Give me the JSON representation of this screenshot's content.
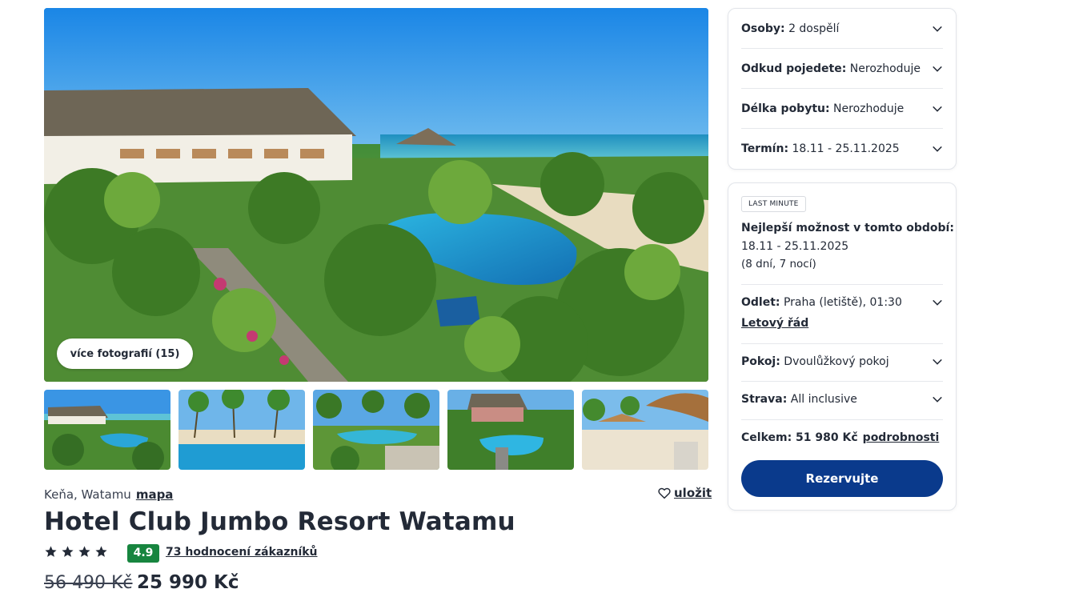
{
  "gallery": {
    "more_photos_label": "více fotografií (15)"
  },
  "hotel": {
    "location": "Keňa, Watamu",
    "map_link": "mapa",
    "save_label": "uložit",
    "name": "Hotel Club Jumbo Resort Watamu",
    "stars": 4,
    "rating": "4.9",
    "reviews_label": "73 hodnocení zákazníků",
    "old_price": "56 490 Kč",
    "price": "25 990 Kč",
    "rating_color": "#17853f"
  },
  "filters": [
    {
      "label": "Osoby:",
      "value": "2 dospělí"
    },
    {
      "label": "Odkud pojedete:",
      "value": "Nerozhoduje"
    },
    {
      "label": "Délka pobytu:",
      "value": "Nerozhoduje"
    },
    {
      "label": "Termín:",
      "value": "18.11 - 25.11.2025"
    }
  ],
  "offer": {
    "badge": "LAST MINUTE",
    "best_title": "Nejlepší možnost v tomto období:",
    "best_dates": "18.11 - 25.11.2025",
    "best_nights": "(8 dní, 7 nocí)",
    "departure_label": "Odlet:",
    "departure_value": "Praha (letiště), 01:30",
    "flight_link": "Letový řád",
    "room_label": "Pokoj:",
    "room_value": "Dvoulůžkový pokoj",
    "board_label": "Strava:",
    "board_value": "All inclusive",
    "total_label": "Celkem: 51 980 Kč",
    "details_link": "podrobnosti",
    "book_label": "Rezervujte",
    "book_color": "#0a3a8c"
  }
}
